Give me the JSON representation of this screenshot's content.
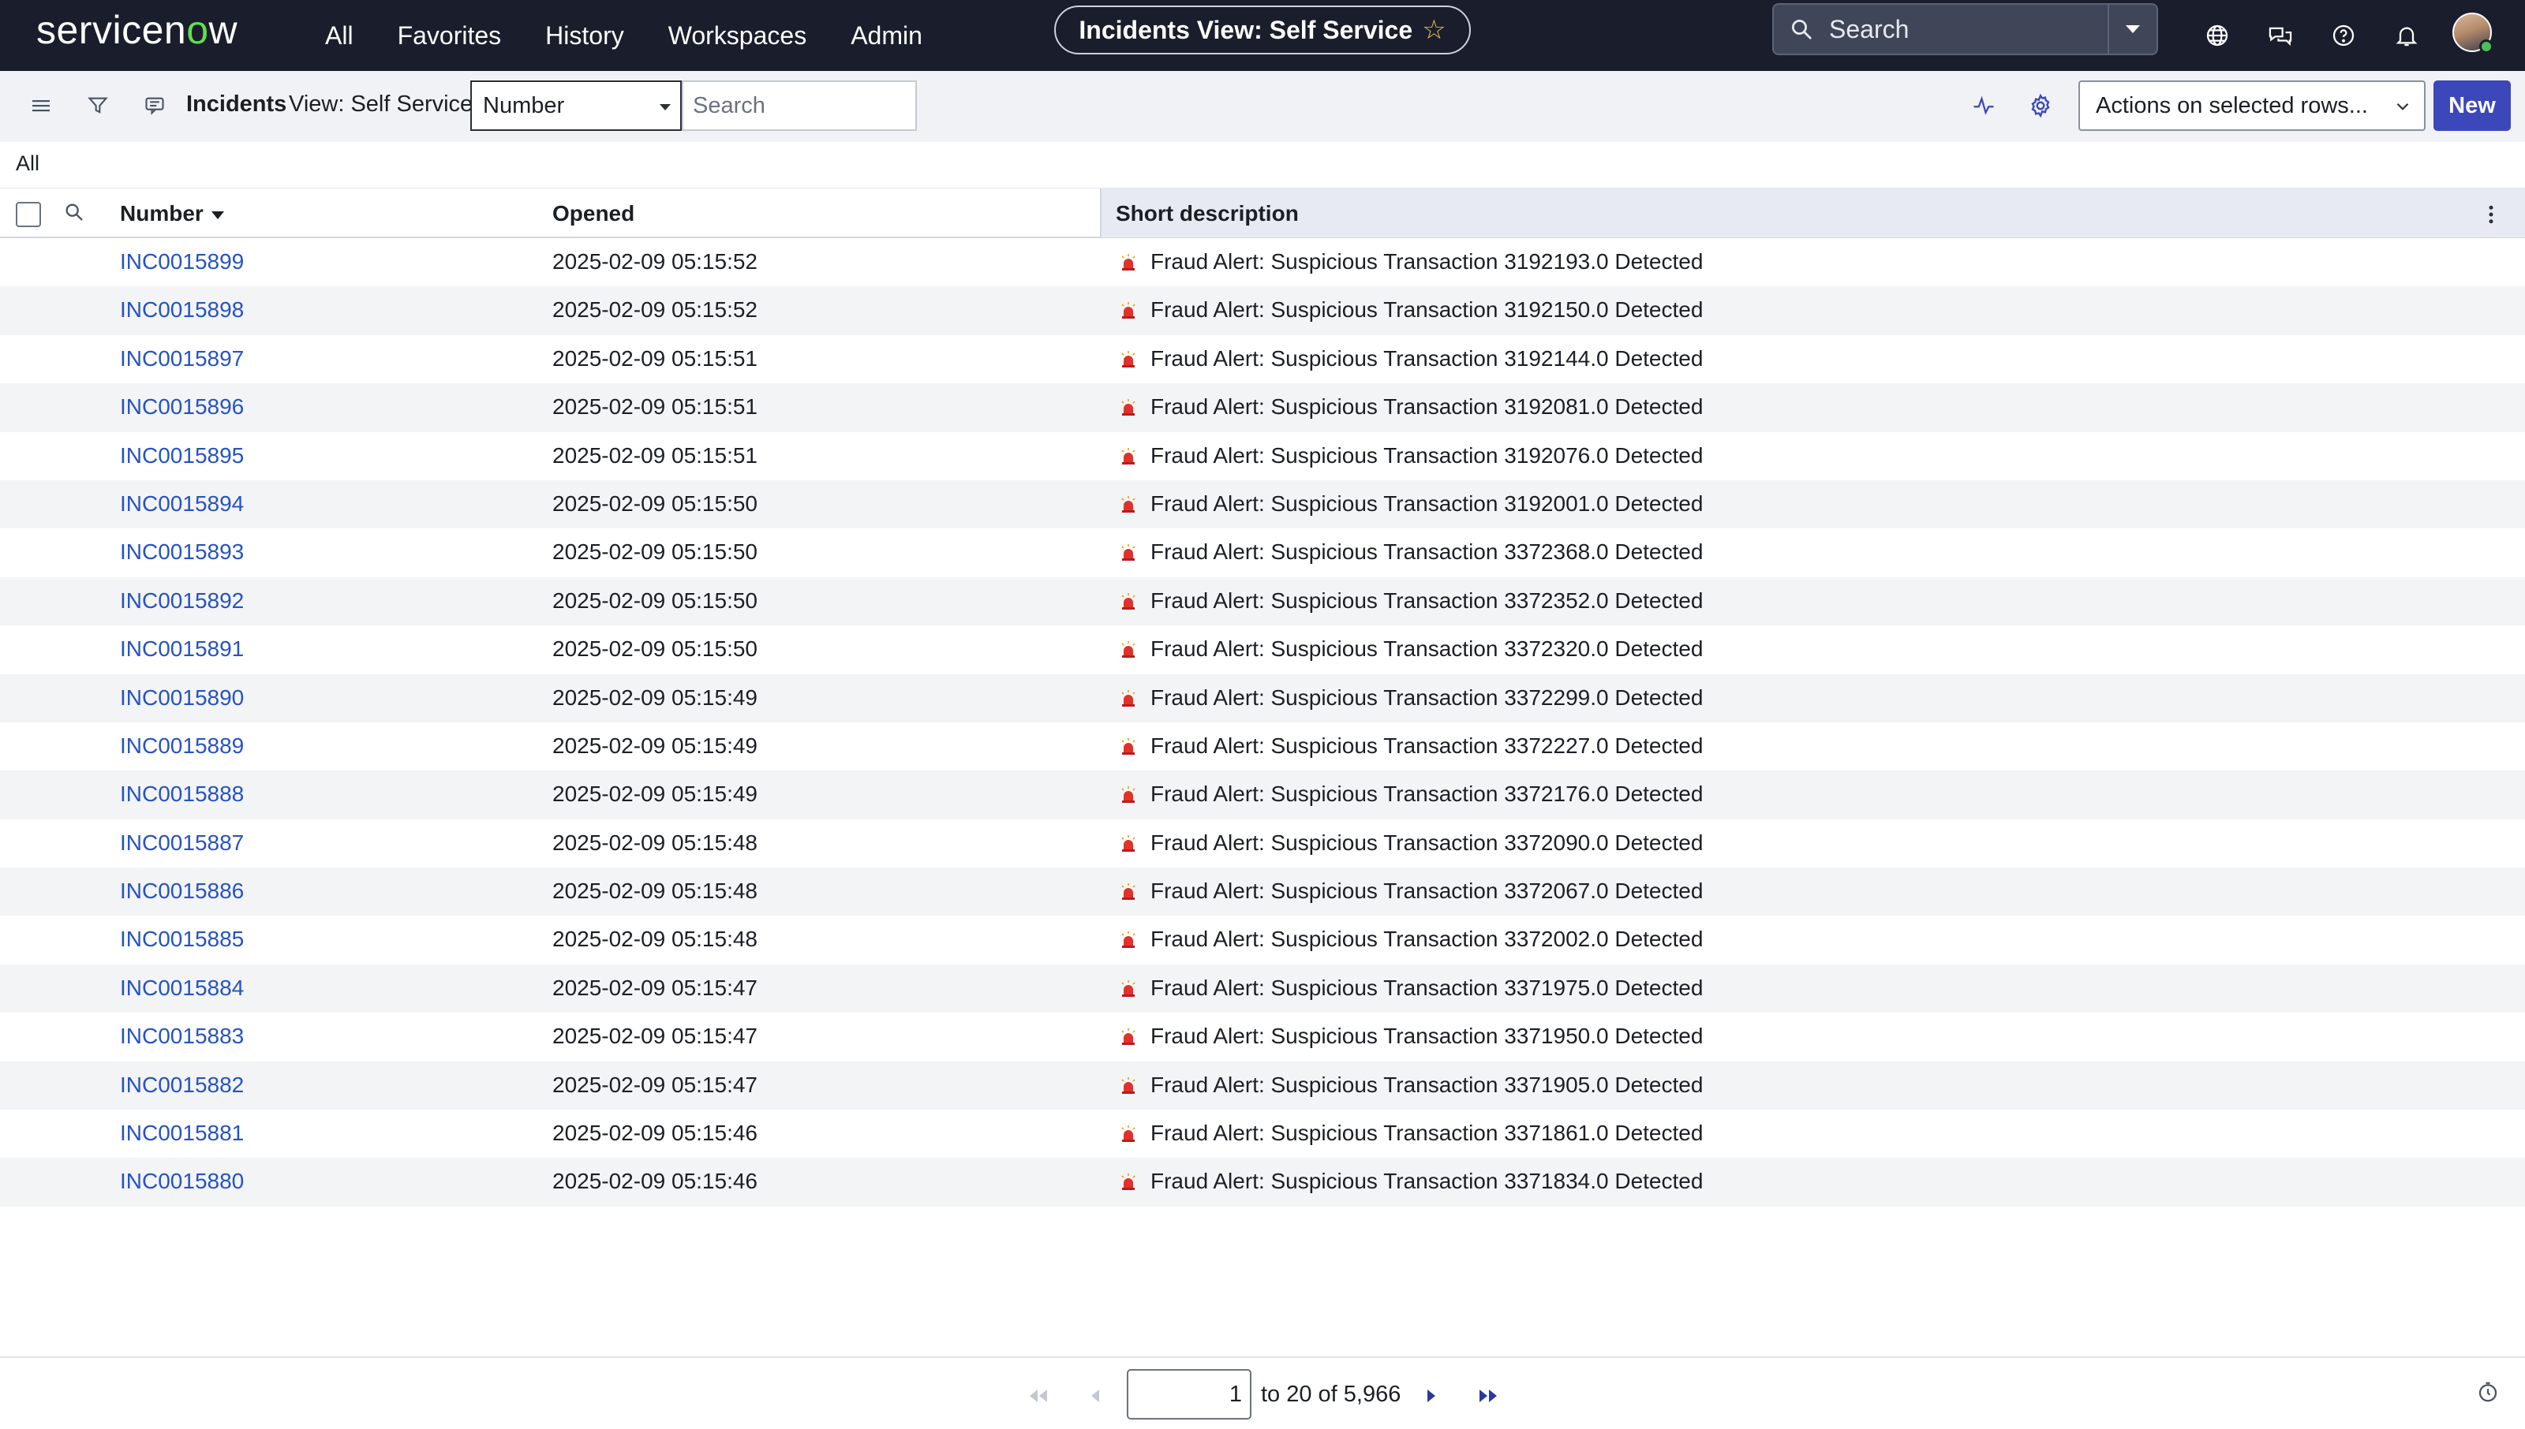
{
  "topnav": {
    "logo": "servicenow",
    "menu": [
      "All",
      "Favorites",
      "History",
      "Workspaces",
      "Admin"
    ],
    "context_title": "Incidents View: Self Service",
    "search_placeholder": "Search"
  },
  "toolbar": {
    "title": "Incidents",
    "view": "View: Self Service",
    "field_selected": "Number",
    "search_placeholder": "Search",
    "actions_label": "Actions on selected rows...",
    "new_label": "New"
  },
  "breadcrumb": "All",
  "table": {
    "columns": [
      "Number",
      "Opened",
      "Short description"
    ],
    "sort_column": "Number",
    "rows": [
      {
        "number": "INC0015899",
        "opened": "2025-02-09 05:15:52",
        "desc": "Fraud Alert: Suspicious Transaction 3192193.0 Detected"
      },
      {
        "number": "INC0015898",
        "opened": "2025-02-09 05:15:52",
        "desc": "Fraud Alert: Suspicious Transaction 3192150.0 Detected"
      },
      {
        "number": "INC0015897",
        "opened": "2025-02-09 05:15:51",
        "desc": "Fraud Alert: Suspicious Transaction 3192144.0 Detected"
      },
      {
        "number": "INC0015896",
        "opened": "2025-02-09 05:15:51",
        "desc": "Fraud Alert: Suspicious Transaction 3192081.0 Detected"
      },
      {
        "number": "INC0015895",
        "opened": "2025-02-09 05:15:51",
        "desc": "Fraud Alert: Suspicious Transaction 3192076.0 Detected"
      },
      {
        "number": "INC0015894",
        "opened": "2025-02-09 05:15:50",
        "desc": "Fraud Alert: Suspicious Transaction 3192001.0 Detected"
      },
      {
        "number": "INC0015893",
        "opened": "2025-02-09 05:15:50",
        "desc": "Fraud Alert: Suspicious Transaction 3372368.0 Detected"
      },
      {
        "number": "INC0015892",
        "opened": "2025-02-09 05:15:50",
        "desc": "Fraud Alert: Suspicious Transaction 3372352.0 Detected"
      },
      {
        "number": "INC0015891",
        "opened": "2025-02-09 05:15:50",
        "desc": "Fraud Alert: Suspicious Transaction 3372320.0 Detected"
      },
      {
        "number": "INC0015890",
        "opened": "2025-02-09 05:15:49",
        "desc": "Fraud Alert: Suspicious Transaction 3372299.0 Detected"
      },
      {
        "number": "INC0015889",
        "opened": "2025-02-09 05:15:49",
        "desc": "Fraud Alert: Suspicious Transaction 3372227.0 Detected"
      },
      {
        "number": "INC0015888",
        "opened": "2025-02-09 05:15:49",
        "desc": "Fraud Alert: Suspicious Transaction 3372176.0 Detected"
      },
      {
        "number": "INC0015887",
        "opened": "2025-02-09 05:15:48",
        "desc": "Fraud Alert: Suspicious Transaction 3372090.0 Detected"
      },
      {
        "number": "INC0015886",
        "opened": "2025-02-09 05:15:48",
        "desc": "Fraud Alert: Suspicious Transaction 3372067.0 Detected"
      },
      {
        "number": "INC0015885",
        "opened": "2025-02-09 05:15:48",
        "desc": "Fraud Alert: Suspicious Transaction 3372002.0 Detected"
      },
      {
        "number": "INC0015884",
        "opened": "2025-02-09 05:15:47",
        "desc": "Fraud Alert: Suspicious Transaction 3371975.0 Detected"
      },
      {
        "number": "INC0015883",
        "opened": "2025-02-09 05:15:47",
        "desc": "Fraud Alert: Suspicious Transaction 3371950.0 Detected"
      },
      {
        "number": "INC0015882",
        "opened": "2025-02-09 05:15:47",
        "desc": "Fraud Alert: Suspicious Transaction 3371905.0 Detected"
      },
      {
        "number": "INC0015881",
        "opened": "2025-02-09 05:15:46",
        "desc": "Fraud Alert: Suspicious Transaction 3371861.0 Detected"
      },
      {
        "number": "INC0015880",
        "opened": "2025-02-09 05:15:46",
        "desc": "Fraud Alert: Suspicious Transaction 3371834.0 Detected"
      }
    ]
  },
  "pagination": {
    "page_value": "1",
    "range_text": "to 20 of 5,966"
  },
  "colors": {
    "nav_bg": "#1a1e2c",
    "link": "#2552c6",
    "primary_button": "#3c47ba",
    "logo_accent": "#63df4e",
    "siren": "#e0322b"
  }
}
